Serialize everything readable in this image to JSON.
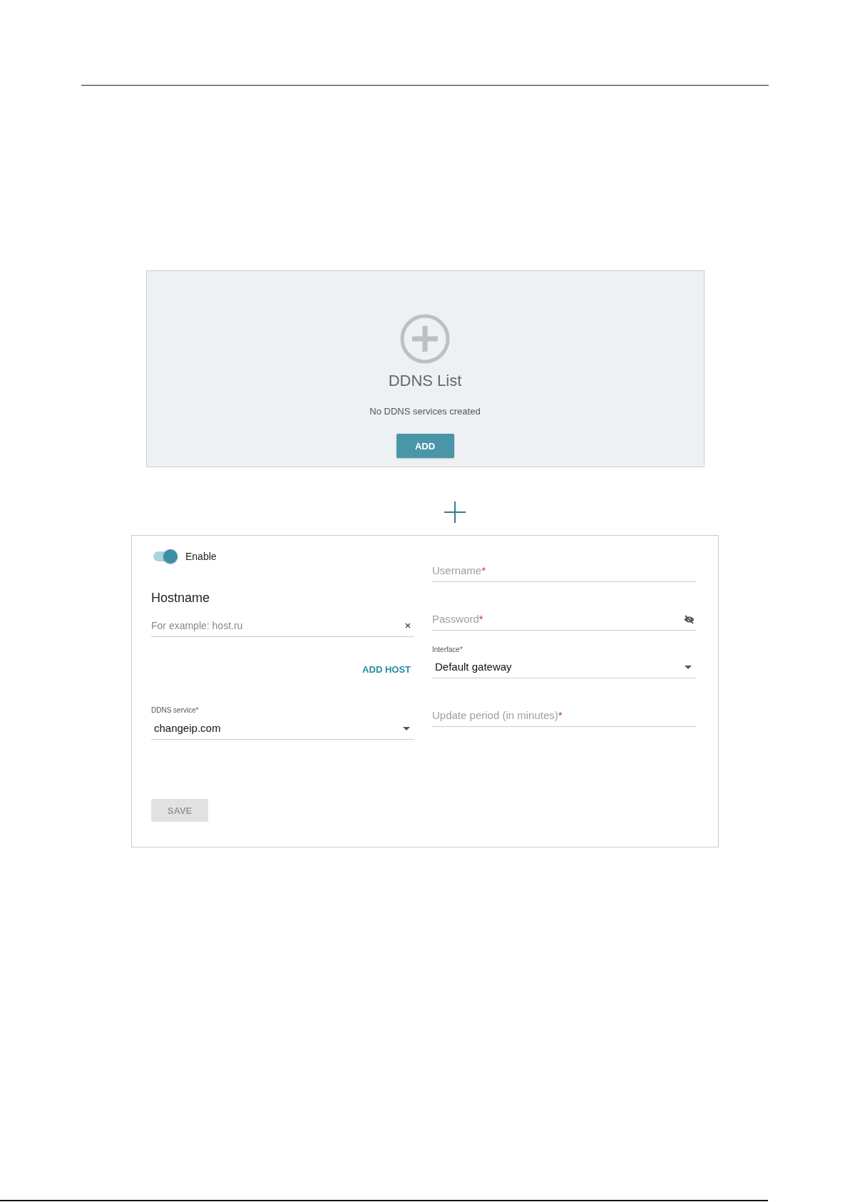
{
  "ddns_list": {
    "title": "DDNS List",
    "message": "No DDNS services created",
    "add_button": "ADD"
  },
  "form": {
    "enable": {
      "label": "Enable",
      "on": true
    },
    "hostname": {
      "heading": "Hostname",
      "placeholder": "For example: host.ru"
    },
    "add_host_button": "ADD HOST",
    "ddns_service": {
      "label": "DDNS service",
      "required_mark": "*",
      "value": "changeip.com"
    },
    "save_button": {
      "label": "SAVE",
      "disabled": true
    },
    "username": {
      "label": "Username",
      "required_mark": "*"
    },
    "password": {
      "label": "Password",
      "required_mark": "*"
    },
    "interface": {
      "label": "Interface",
      "required_mark": "*",
      "value": "Default gateway"
    },
    "update_period": {
      "label": "Update period (in minutes)",
      "required_mark": "*"
    }
  }
}
